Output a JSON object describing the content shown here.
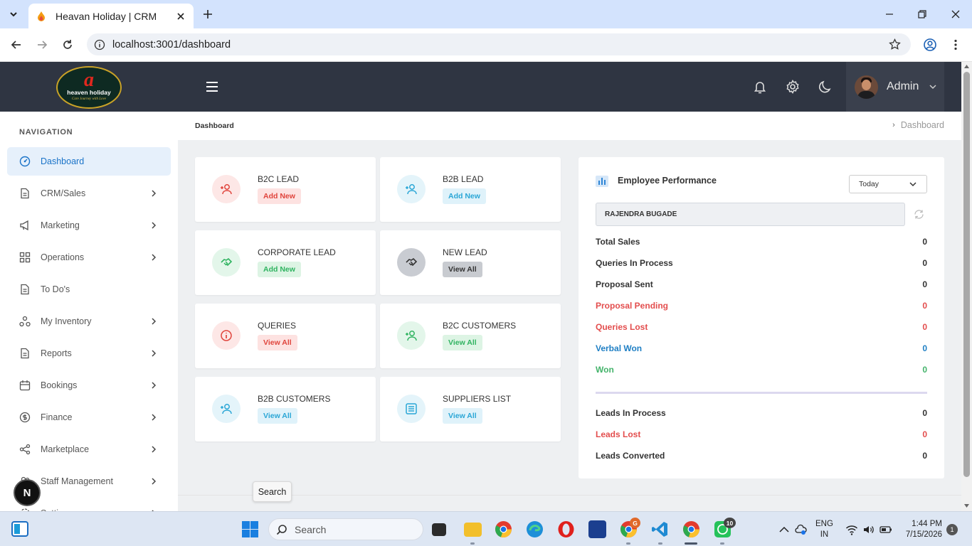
{
  "browser": {
    "tab_title": "Heavan Holiday | CRM",
    "url": "localhost:3001/dashboard"
  },
  "header": {
    "logo_initial": "a",
    "logo_brand": "heaven holiday",
    "logo_tagline": "Care Journey with Love",
    "user_name": "Admin"
  },
  "sidebar": {
    "heading": "NAVIGATION",
    "items": [
      {
        "label": "Dashboard",
        "icon": "dashboard-icon",
        "active": true
      },
      {
        "label": "CRM/Sales",
        "icon": "document-icon"
      },
      {
        "label": "Marketing",
        "icon": "megaphone-icon"
      },
      {
        "label": "Operations",
        "icon": "grid-icon"
      },
      {
        "label": "To Do's",
        "icon": "document-icon"
      },
      {
        "label": "My Inventory",
        "icon": "nodes-icon"
      },
      {
        "label": "Reports",
        "icon": "document-icon"
      },
      {
        "label": "Bookings",
        "icon": "calendar-icon"
      },
      {
        "label": "Finance",
        "icon": "dollar-icon"
      },
      {
        "label": "Marketplace",
        "icon": "share-icon"
      },
      {
        "label": "Staff Management",
        "icon": "users-icon"
      },
      {
        "label": "Settings",
        "icon": "gear-icon"
      }
    ]
  },
  "breadcrumb": {
    "left": "Dashboard",
    "right": "Dashboard"
  },
  "cards": [
    {
      "title": "B2C LEAD",
      "action": "Add New",
      "color": "red",
      "icon": "add-user-icon"
    },
    {
      "title": "B2B LEAD",
      "action": "Add New",
      "color": "blue",
      "icon": "add-user-icon"
    },
    {
      "title": "CORPORATE LEAD",
      "action": "Add New",
      "color": "green",
      "icon": "handshake-icon"
    },
    {
      "title": "NEW LEAD",
      "action": "View All",
      "color": "gray",
      "icon": "handshake-icon"
    },
    {
      "title": "QUERIES",
      "action": "View All",
      "color": "red",
      "icon": "info-icon"
    },
    {
      "title": "B2C CUSTOMERS",
      "action": "View All",
      "color": "green",
      "icon": "add-user-icon"
    },
    {
      "title": "B2B CUSTOMERS",
      "action": "View All",
      "color": "blue",
      "icon": "add-user-icon"
    },
    {
      "title": "SUPPLIERS LIST",
      "action": "View All",
      "color": "blue",
      "icon": "list-icon"
    }
  ],
  "performance": {
    "title": "Employee Performance",
    "period": "Today",
    "employee": "RAJENDRA BUGADE",
    "stats": [
      {
        "label": "Total Sales",
        "value": "0",
        "color": "default"
      },
      {
        "label": "Queries In Process",
        "value": "0",
        "color": "default"
      },
      {
        "label": "Proposal Sent",
        "value": "0",
        "color": "default"
      },
      {
        "label": "Proposal Pending",
        "value": "0",
        "color": "red"
      },
      {
        "label": "Queries Lost",
        "value": "0",
        "color": "red"
      },
      {
        "label": "Verbal Won",
        "value": "0",
        "color": "blue"
      },
      {
        "label": "Won",
        "value": "0",
        "color": "green"
      }
    ],
    "leads": [
      {
        "label": "Leads In Process",
        "value": "0",
        "color": "default"
      },
      {
        "label": "Leads Lost",
        "value": "0",
        "color": "red"
      },
      {
        "label": "Leads Converted",
        "value": "0",
        "color": "default"
      }
    ]
  },
  "overlay": {
    "n_badge": "N",
    "tooltip": "Search"
  },
  "taskbar": {
    "search_placeholder": "Search",
    "chrome_badge": "G",
    "whatsapp_badge": "10",
    "lang_top": "ENG",
    "lang_bottom": "IN",
    "time": "1:44 PM",
    "date": "7/15/2026",
    "notifications": "1"
  }
}
